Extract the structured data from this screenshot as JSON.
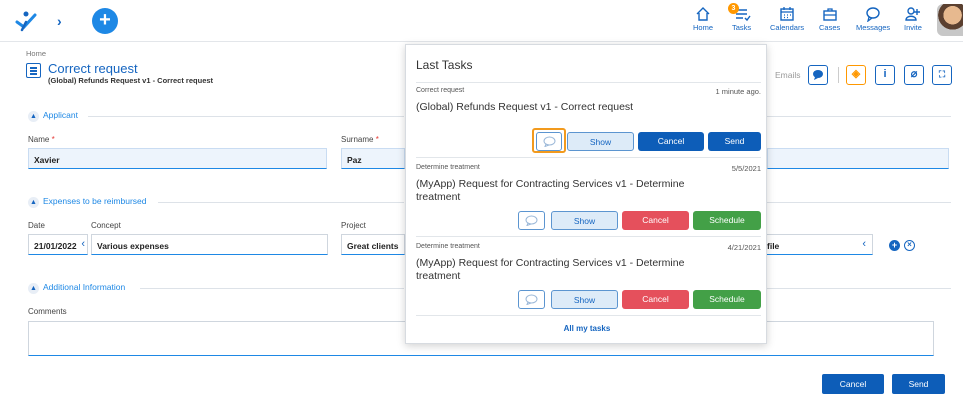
{
  "topbar": {
    "nav": [
      {
        "label": "Home",
        "icon": "home-icon"
      },
      {
        "label": "Tasks",
        "icon": "tasks-icon",
        "badge": "3"
      },
      {
        "label": "Calendars",
        "icon": "calendar-icon"
      },
      {
        "label": "Cases",
        "icon": "briefcase-icon"
      },
      {
        "label": "Messages",
        "icon": "chat-icon"
      },
      {
        "label": "Invite",
        "icon": "add-user-icon"
      }
    ],
    "plus_label": "+",
    "chevron": "›"
  },
  "header": {
    "breadcrumb": "Home",
    "title": "Correct request",
    "subtitle": "(Global) Refunds Request v1 - Correct request",
    "emails_label": "Emails",
    "toolbar_icons": [
      "chat-bubble-icon",
      "diamond-icon",
      "info-icon",
      "attachment-icon",
      "map-icon"
    ]
  },
  "applicant": {
    "section_label": "Applicant",
    "name_label": "Name",
    "name_value": "Xavier",
    "surname_label": "Surname",
    "surname_value": "Paz",
    "required_mark": "*"
  },
  "expenses": {
    "section_label": "Expenses to be reimbursed",
    "date_label": "Date",
    "date_value": "21/01/2022",
    "concept_label": "Concept",
    "concept_value": "Various expenses",
    "project_label": "Project",
    "project_value": "Great clients",
    "file_value": "file"
  },
  "additional": {
    "section_label": "Additional Information",
    "comments_label": "Comments",
    "comments_value": ""
  },
  "footer": {
    "cancel_label": "Cancel",
    "send_label": "Send"
  },
  "popup": {
    "title": "Last Tasks",
    "tasks": [
      {
        "step": "Correct request",
        "time": "1 minute ago.",
        "name": "(Global) Refunds Request v1 - Correct request",
        "show": "Show",
        "cancel": "Cancel",
        "action": "Send"
      },
      {
        "step": "Determine treatment",
        "time": "5/5/2021",
        "name": "(MyApp) Request for Contracting Services v1 - Determine treatment",
        "show": "Show",
        "cancel": "Cancel",
        "action": "Schedule"
      },
      {
        "step": "Determine treatment",
        "time": "4/21/2021",
        "name": "(MyApp) Request for Contracting Services v1 - Determine treatment",
        "show": "Show",
        "cancel": "Cancel",
        "action": "Schedule"
      }
    ],
    "all_tasks_label": "All my tasks"
  },
  "colors": {
    "primary": "#1565c0",
    "accent": "#1e88e5",
    "highlight": "#f29a1d",
    "danger": "#e5505c",
    "success": "#43a047"
  }
}
